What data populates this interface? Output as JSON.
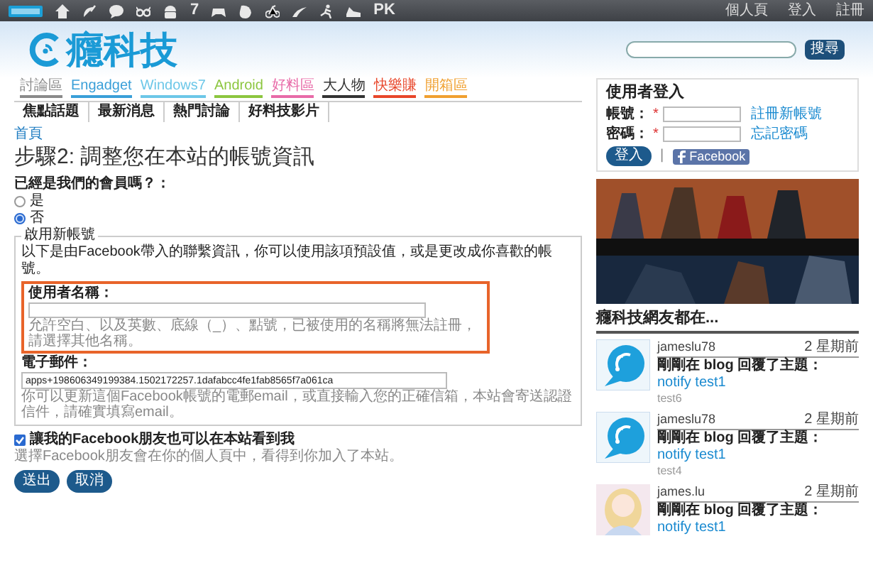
{
  "top_bar": {
    "text_icons": [
      "7",
      "PK"
    ],
    "links": [
      "個人頁",
      "登入",
      "註冊"
    ]
  },
  "header": {
    "logo": "癮科技",
    "search_button": "搜尋"
  },
  "categories": [
    {
      "label": "討論區",
      "color": "#8a8a8a"
    },
    {
      "label": "Engadget",
      "color": "#3a9fd8"
    },
    {
      "label": "Windows7",
      "color": "#6cc7e8"
    },
    {
      "label": "Android",
      "color": "#8cc63f"
    },
    {
      "label": "好料區",
      "color": "#e86aa8"
    },
    {
      "label": "大人物",
      "color": "#333333"
    },
    {
      "label": "快樂賺",
      "color": "#e8462a"
    },
    {
      "label": "開箱區",
      "color": "#f0a030"
    }
  ],
  "tabs": [
    "焦點話題",
    "最新消息",
    "熱門討論",
    "好料技影片"
  ],
  "breadcrumb": "首頁",
  "page_title": "步驟2: 調整您在本站的帳號資訊",
  "member_question": "已經是我們的會員嗎？：",
  "member_options": [
    {
      "label": "是",
      "selected": false
    },
    {
      "label": "否",
      "selected": true
    }
  ],
  "new_account": {
    "legend": "啟用新帳號",
    "description": "以下是由Facebook帶入的聯繫資訊，你可以使用該項預設值，或是更改成你喜歡的帳號。",
    "username": {
      "label": "使用者名稱：",
      "hint": "允許空白、以及英數、底線（_）、點號，已被使用的名稱將無法註冊，請選擇其他名稱。"
    },
    "email": {
      "label": "電子郵件：",
      "value": "apps+198606349199384.1502172257.1dafabcc4fe1fab8565f7a061ca",
      "hint": "你可以更新這個Facebook帳號的電郵email，或直接輸入您的正確信箱，本站會寄送認證信件，請確實填寫email。"
    }
  },
  "share_option": {
    "label": "讓我的Facebook朋友也可以在本站看到我",
    "checked": true,
    "hint": "選擇Facebook朋友會在你的個人頁中，看得到你加入了本站。"
  },
  "buttons": [
    "送出",
    "取消"
  ],
  "login": {
    "title": "使用者登入",
    "fields": [
      {
        "label": "帳號：",
        "required_mark": "*",
        "link": "註冊新帳號"
      },
      {
        "label": "密碼：",
        "required_mark": "*",
        "link": "忘記密碼"
      }
    ],
    "submit": "登入",
    "separator": "|",
    "facebook": "Facebook"
  },
  "friends": {
    "title": "癮科技網友都在...",
    "items": [
      {
        "kind": "default",
        "user": "jameslu78",
        "time": "2 星期前",
        "action": "剛剛在 blog 回覆了主題：",
        "topic": "notify test1",
        "note": "test6"
      },
      {
        "kind": "default",
        "user": "jameslu78",
        "time": "2 星期前",
        "action": "剛剛在 blog 回覆了主題：",
        "topic": "notify test1",
        "note": "test4"
      },
      {
        "user": "james.lu",
        "time": "2 星期前",
        "action": "剛剛在 blog 回覆了主題：",
        "topic": "notify test1"
      }
    ]
  }
}
